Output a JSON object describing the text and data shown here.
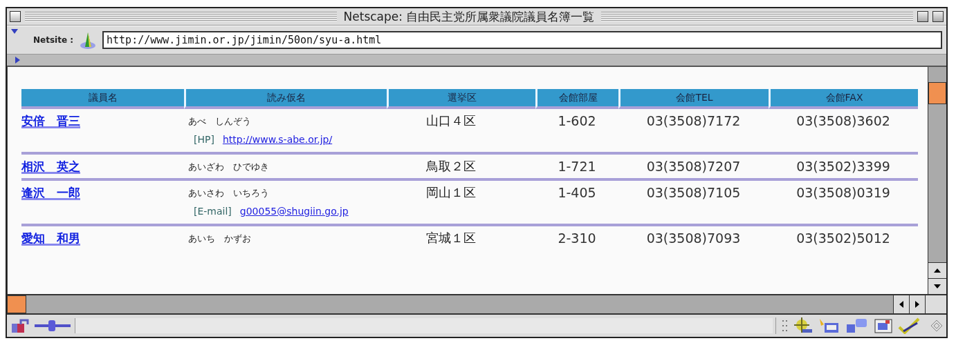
{
  "window": {
    "title": "Netscape: 自由民主党所属衆議院議員名簿一覧"
  },
  "location": {
    "label": "Netsite :",
    "url": "http://www.jimin.or.jp/jimin/50on/syu-a.html"
  },
  "table": {
    "columns": [
      "議員名",
      "読み仮名",
      "選挙区",
      "会館部屋",
      "会館TEL",
      "会館FAX"
    ],
    "rows": [
      {
        "name": "安倍　晋三",
        "reading": "あべ　しんぞう",
        "district": "山口４区",
        "room": "1-602",
        "tel": "03(3508)7172",
        "fax": "03(3508)3602",
        "link": {
          "label": "[HP]",
          "text": "http://www.s-abe.or.jp/"
        }
      },
      {
        "name": "相沢　英之",
        "reading": "あいざわ　ひでゆき",
        "district": "鳥取２区",
        "room": "1-721",
        "tel": "03(3508)7207",
        "fax": "03(3502)3399"
      },
      {
        "name": "逢沢　一郎",
        "reading": "あいさわ　いちろう",
        "district": "岡山１区",
        "room": "1-405",
        "tel": "03(3508)7105",
        "fax": "03(3508)0319",
        "link": {
          "label": "[E-mail]",
          "text": "g00055@shugiin.go.jp"
        }
      },
      {
        "name": "愛知　和男",
        "reading": "あいち　かずお",
        "district": "宮城１区",
        "room": "2-310",
        "tel": "03(3508)7093",
        "fax": "03(3502)5012"
      }
    ]
  }
}
